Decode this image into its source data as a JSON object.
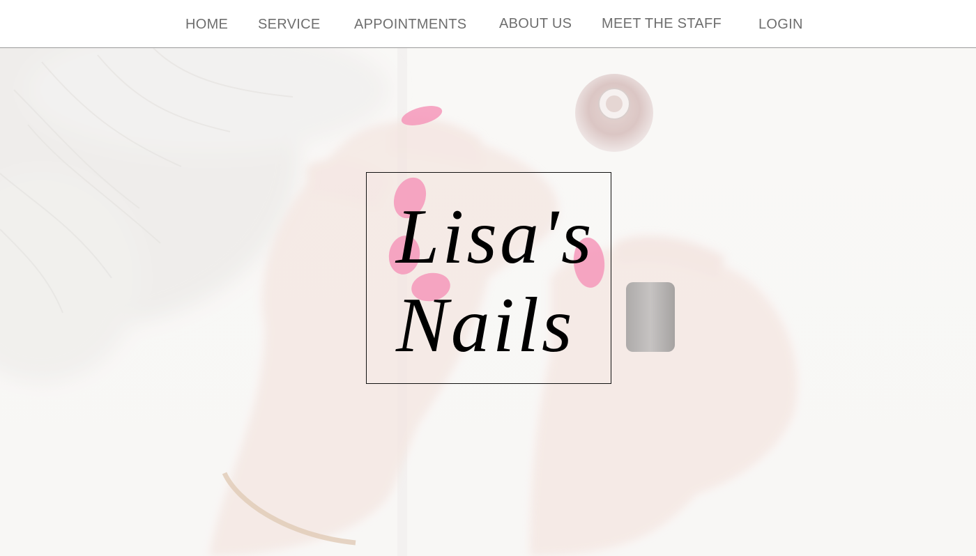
{
  "nav": {
    "home": "HOME",
    "service": "SERVICE",
    "appointments": "APPOINTMENTS",
    "about": "ABOUT US",
    "staff": "MEET THE STAFF",
    "login": "LOGIN"
  },
  "hero": {
    "logo_line_1": "Lisa's",
    "logo_line_2": "Nails"
  },
  "colors": {
    "nav_text": "#6e6e6e",
    "nail_polish": "#f06a9a",
    "logo_text": "#000000"
  }
}
